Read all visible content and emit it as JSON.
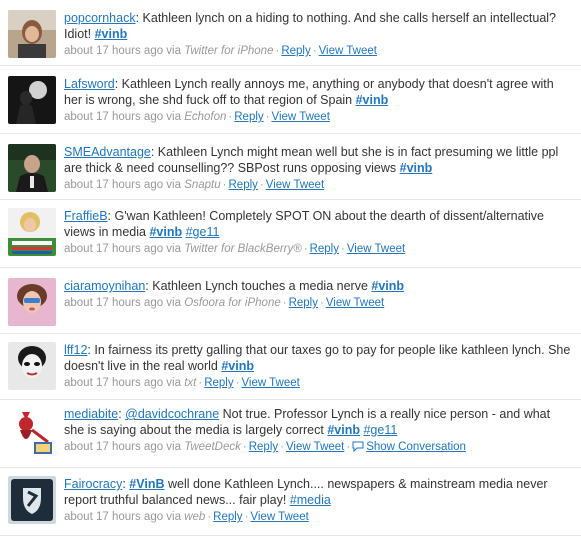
{
  "tweets": [
    {
      "user": "popcornhack",
      "text_before": ": Kathleen lynch on a hiding to nothing. And she calls herself an intellectual? Idiot! ",
      "hashtag1": "#vinb",
      "time": "about 17 hours ago via ",
      "source": "Twitter for iPhone",
      "reply": "Reply",
      "view": "View Tweet"
    },
    {
      "user": "Lafsword",
      "text_before": ": Kathleen Lynch really annoys me, anything or anybody that doesn't agree with her is wrong, she shd fuck off to that region of Spain ",
      "hashtag1": "#vinb",
      "time": "about 17 hours ago via ",
      "source": "Echofon",
      "reply": "Reply",
      "view": "View Tweet"
    },
    {
      "user": "SMEAdvantage",
      "text_before": ": Kathleen Lynch might mean well but she is in fact presuming we little ppl are thick & need counselling?? SBPost runs opposing views ",
      "hashtag1": "#vinb",
      "time": "about 17 hours ago via ",
      "source": "Snaptu",
      "reply": "Reply",
      "view": "View Tweet"
    },
    {
      "user": "FraffieB",
      "text_before": ": G'wan Kathleen! Completely SPOT ON about the dearth of dissent/alternative views in media ",
      "hashtag1": "#vinb",
      "hashtag2": "#ge11",
      "time": "about 17 hours ago via ",
      "source": "Twitter for BlackBerry®",
      "reply": "Reply",
      "view": "View Tweet"
    },
    {
      "user": "ciaramoynihan",
      "text_before": ": Kathleen Lynch touches a media nerve ",
      "hashtag1": "#vinb",
      "time": "about 17 hours ago via ",
      "source": "Osfoora for iPhone",
      "reply": "Reply",
      "view": "View Tweet"
    },
    {
      "user": "lff12",
      "text_before": ": In fairness its pretty galling that our taxes go to pay for people like kathleen lynch. She doesn't live in the real world ",
      "hashtag1": "#vinb",
      "time": "about 17 hours ago via ",
      "source": "txt",
      "reply": "Reply",
      "view": "View Tweet"
    },
    {
      "user": "mediabite",
      "mention": "@davidcochrane",
      "text_before": " Not true. Professor Lynch is a really nice person - and what she is saying about the media is largely correct ",
      "hashtag1": "#vinb",
      "hashtag2": "#ge11",
      "time": "about 17 hours ago via ",
      "source": "TweetDeck",
      "reply": "Reply",
      "view": "View Tweet",
      "conversation": "Show Conversation"
    },
    {
      "user": "Fairocracy",
      "hashtag0": "#VinB",
      "text_before": " well done Kathleen Lynch.... newspapers & mainstream media never report truthful balanced news... fair play! ",
      "hashtag1": "#media",
      "time": "about 17 hours ago via ",
      "source": "web",
      "reply": "Reply",
      "view": "View Tweet"
    }
  ],
  "separator": "·",
  "colors": {
    "link": "#2276bb",
    "meta": "#999999",
    "text": "#333333"
  }
}
